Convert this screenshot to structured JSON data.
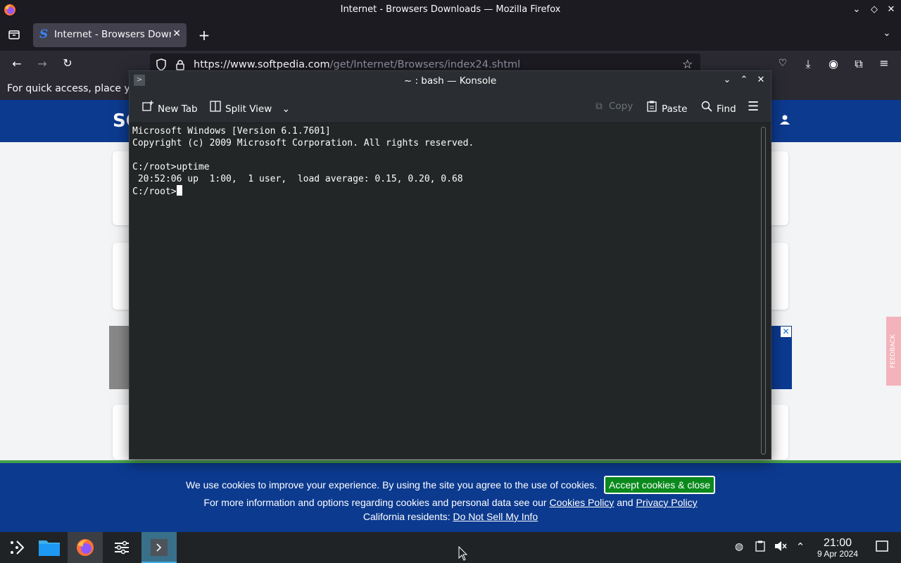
{
  "firefox": {
    "window_title": "Internet - Browsers Downloads — Mozilla Firefox",
    "tab_title": "Internet - Browsers Downloads",
    "url_host": "https://www.softpedia.com",
    "url_path": "/get/Internet/Browsers/index24.shtml",
    "bookmarks_hint": "For quick access, place yo"
  },
  "site": {
    "logo_text": "SC"
  },
  "cookie_banner": {
    "message": "We use cookies to improve your experience. By using the site you agree to the use of cookies.",
    "accept_label": "Accept cookies & close",
    "info_prefix": "For more information and options regarding cookies and personal data see our",
    "cookies_policy": "Cookies Policy",
    "and": "and",
    "privacy_policy": "Privacy Policy",
    "ca_prefix": "California residents:",
    "do_not_sell": "Do Not Sell My Info"
  },
  "ad": {
    "feedback_label": "FEEDBACK"
  },
  "konsole": {
    "title": "~ : bash — Konsole",
    "toolbar": {
      "new_tab": "New Tab",
      "split_view": "Split View",
      "copy": "Copy",
      "paste": "Paste",
      "find": "Find"
    },
    "terminal": {
      "lines": [
        "Microsoft Windows [Version 6.1.7601]",
        "Copyright (c) 2009 Microsoft Corporation. All rights reserved.",
        "",
        "C:/root>uptime",
        " 20:52:06 up  1:00,  1 user,  load average: 0.15, 0.20, 0.68"
      ],
      "prompt": "C:/root>"
    }
  },
  "taskbar": {
    "time": "21:00",
    "date": "9 Apr 2024"
  },
  "colors": {
    "site_blue": "#0c3a8f",
    "accept_green": "#0a8a1c",
    "konsole_bg": "#232627"
  }
}
